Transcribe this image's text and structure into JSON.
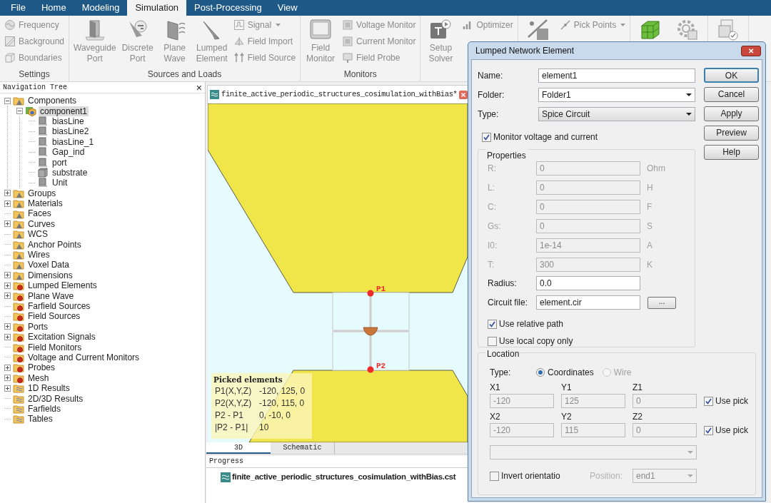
{
  "menu": [
    {
      "label": "File",
      "selected": false
    },
    {
      "label": "Home",
      "selected": false
    },
    {
      "label": "Modeling",
      "selected": false
    },
    {
      "label": "Simulation",
      "selected": true
    },
    {
      "label": "Post-Processing",
      "selected": false
    },
    {
      "label": "View",
      "selected": false
    }
  ],
  "ribbon": {
    "groups": [
      {
        "label": "Settings",
        "columns": [
          {
            "kind": "stack",
            "items": [
              {
                "label": "Frequency",
                "menu": false
              },
              {
                "label": "Background",
                "menu": false
              },
              {
                "label": "Boundaries",
                "menu": false
              }
            ]
          }
        ]
      },
      {
        "label": "Sources and Loads",
        "columns": [
          {
            "kind": "large",
            "label": "Waveguide Port"
          },
          {
            "kind": "large",
            "label": "Discrete Port"
          },
          {
            "kind": "large",
            "label": "Plane Wave"
          },
          {
            "kind": "large",
            "label": "Lumped Element"
          },
          {
            "kind": "stack",
            "items": [
              {
                "label": "Signal",
                "menu": true
              },
              {
                "label": "Field Import",
                "menu": false
              },
              {
                "label": "Field Source",
                "menu": false
              }
            ]
          }
        ]
      },
      {
        "label": "Monitors",
        "columns": [
          {
            "kind": "large",
            "label": "Field Monitor"
          },
          {
            "kind": "stack",
            "items": [
              {
                "label": "Voltage Monitor",
                "menu": false
              },
              {
                "label": "Current Monitor",
                "menu": false
              },
              {
                "label": "Field Probe",
                "menu": false
              }
            ]
          }
        ]
      },
      {
        "columns": [
          {
            "kind": "large",
            "label": "Setup Solver"
          },
          {
            "kind": "stack",
            "items": [
              {
                "label": "Optimizer",
                "menu": false
              }
            ]
          }
        ]
      },
      {
        "columns": [
          {
            "kind": "large"
          },
          {
            "kind": "stack",
            "items": [
              {
                "label": "Pick Points",
                "menu": true
              }
            ]
          }
        ]
      },
      {
        "columns": [
          {
            "kind": "large"
          },
          {
            "kind": "large"
          }
        ]
      },
      {
        "columns": [
          {
            "kind": "large"
          }
        ]
      }
    ]
  },
  "navigation_tree": {
    "title": "Navigation Tree",
    "close": "×",
    "items": [
      {
        "label": "Components",
        "expanded": true,
        "selected": false,
        "children": [
          {
            "label": "component1",
            "expanded": true,
            "selected": true,
            "children": [
              {
                "label": "biasLine",
                "selected": false
              },
              {
                "label": "biasLine2",
                "selected": false
              },
              {
                "label": "biasLine_1",
                "selected": false
              },
              {
                "label": "Gap_ind",
                "selected": false
              },
              {
                "label": "port",
                "selected": false
              },
              {
                "label": "substrate",
                "selected": false
              },
              {
                "label": "Unit",
                "selected": false
              }
            ]
          }
        ]
      },
      {
        "label": "Groups",
        "expanded": false,
        "selected": false
      },
      {
        "label": "Materials",
        "expanded": false,
        "selected": false
      },
      {
        "label": "Faces",
        "selected": false
      },
      {
        "label": "Curves",
        "expanded": false,
        "selected": false
      },
      {
        "label": "WCS",
        "selected": false
      },
      {
        "label": "Anchor Points",
        "selected": false
      },
      {
        "label": "Wires",
        "selected": false
      },
      {
        "label": "Voxel Data",
        "selected": false
      },
      {
        "label": "Dimensions",
        "expanded": false,
        "selected": false
      },
      {
        "label": "Lumped Elements",
        "expanded": false,
        "selected": false
      },
      {
        "label": "Plane Wave",
        "expanded": false,
        "selected": false
      },
      {
        "label": "Farfield Sources",
        "selected": false
      },
      {
        "label": "Field Sources",
        "selected": false
      },
      {
        "label": "Ports",
        "expanded": false,
        "selected": false
      },
      {
        "label": "Excitation Signals",
        "expanded": false,
        "selected": false
      },
      {
        "label": "Field Monitors",
        "selected": false
      },
      {
        "label": "Voltage and Current Monitors",
        "selected": false
      },
      {
        "label": "Probes",
        "expanded": false,
        "selected": false
      },
      {
        "label": "Mesh",
        "expanded": false,
        "selected": false
      },
      {
        "label": "1D Results",
        "expanded": false,
        "selected": false
      },
      {
        "label": "2D/3D Results",
        "selected": false
      },
      {
        "label": "Farfields",
        "selected": false
      },
      {
        "label": "Tables",
        "selected": false
      }
    ]
  },
  "document": {
    "tab": {
      "title": "finite_active_periodic_structures_cosimulation_withBias*"
    },
    "points": [
      {
        "label": "P1"
      },
      {
        "label": "P2"
      }
    ],
    "picked": {
      "title": "Picked elements",
      "rows": [
        {
          "label": "P1(X,Y,Z)",
          "value": "-120, 125, 0"
        },
        {
          "label": "P2(X,Y,Z)",
          "value": "-120, 115, 0"
        },
        {
          "label": "P2 - P1",
          "value": "0, -10, 0"
        },
        {
          "label": "|P2 - P1|",
          "value": "10"
        }
      ]
    },
    "view_tabs": [
      {
        "label": "3D",
        "selected": true
      },
      {
        "label": "Schematic",
        "selected": false
      }
    ]
  },
  "progress": {
    "title": "Progress",
    "items": [
      "finite_active_periodic_structures_cosimulation_withBias.cst"
    ]
  },
  "dialog": {
    "title": "Lumped Network Element",
    "close": "✕",
    "buttons": [
      {
        "label": "OK",
        "default": true
      },
      {
        "label": "Cancel",
        "default": false
      },
      {
        "label": "Apply",
        "default": false
      },
      {
        "label": "Preview",
        "default": false
      },
      {
        "label": "Help",
        "default": false
      }
    ],
    "fields": [
      {
        "label": "Name:",
        "value": "element1",
        "kind": "text"
      },
      {
        "label": "Folder:",
        "value": "Folder1",
        "kind": "combo"
      },
      {
        "label": "Type:",
        "value": "Spice Circuit",
        "kind": "select"
      }
    ],
    "monitor": {
      "label": "Monitor voltage and current",
      "checked": true
    },
    "properties": {
      "title": "Properties",
      "rows": [
        {
          "label": "R:",
          "value": "0",
          "unit": "Ohm",
          "disabled": true
        },
        {
          "label": "L:",
          "value": "0",
          "unit": "H",
          "disabled": true
        },
        {
          "label": "C:",
          "value": "0",
          "unit": "F",
          "disabled": true
        },
        {
          "label": "Gs:",
          "value": "0",
          "unit": "S",
          "disabled": true
        },
        {
          "label": "I0:",
          "value": "1e-14",
          "unit": "A",
          "disabled": true
        },
        {
          "label": "T:",
          "value": "300",
          "unit": "K",
          "disabled": true
        }
      ],
      "radius": {
        "label": "Radius:",
        "value": "0.0"
      },
      "circuit_file": {
        "label": "Circuit file:",
        "value": "element.cir",
        "browse": "..."
      },
      "options": [
        {
          "label": "Use relative path",
          "checked": true
        },
        {
          "label": "Use local copy only",
          "checked": false
        }
      ]
    },
    "location": {
      "title": "Location",
      "type_label": "Type:",
      "radios": [
        {
          "label": "Coordinates",
          "selected": true,
          "disabled": false
        },
        {
          "label": "Wire",
          "selected": false,
          "disabled": true
        }
      ],
      "points": [
        {
          "fields": [
            {
              "label": "X1",
              "value": "-120"
            },
            {
              "label": "Y1",
              "value": "125"
            },
            {
              "label": "Z1",
              "value": "0"
            }
          ],
          "use_pick": {
            "label": "Use pick",
            "checked": true
          }
        },
        {
          "fields": [
            {
              "label": "X2",
              "value": "-120"
            },
            {
              "label": "Y2",
              "value": "115"
            },
            {
              "label": "Z2",
              "value": "0"
            }
          ],
          "use_pick": {
            "label": "Use pick",
            "checked": true
          }
        }
      ],
      "invert": {
        "label": "Invert orientatio",
        "checked": false
      },
      "position": {
        "label": "Position:",
        "value": "end1"
      }
    }
  }
}
